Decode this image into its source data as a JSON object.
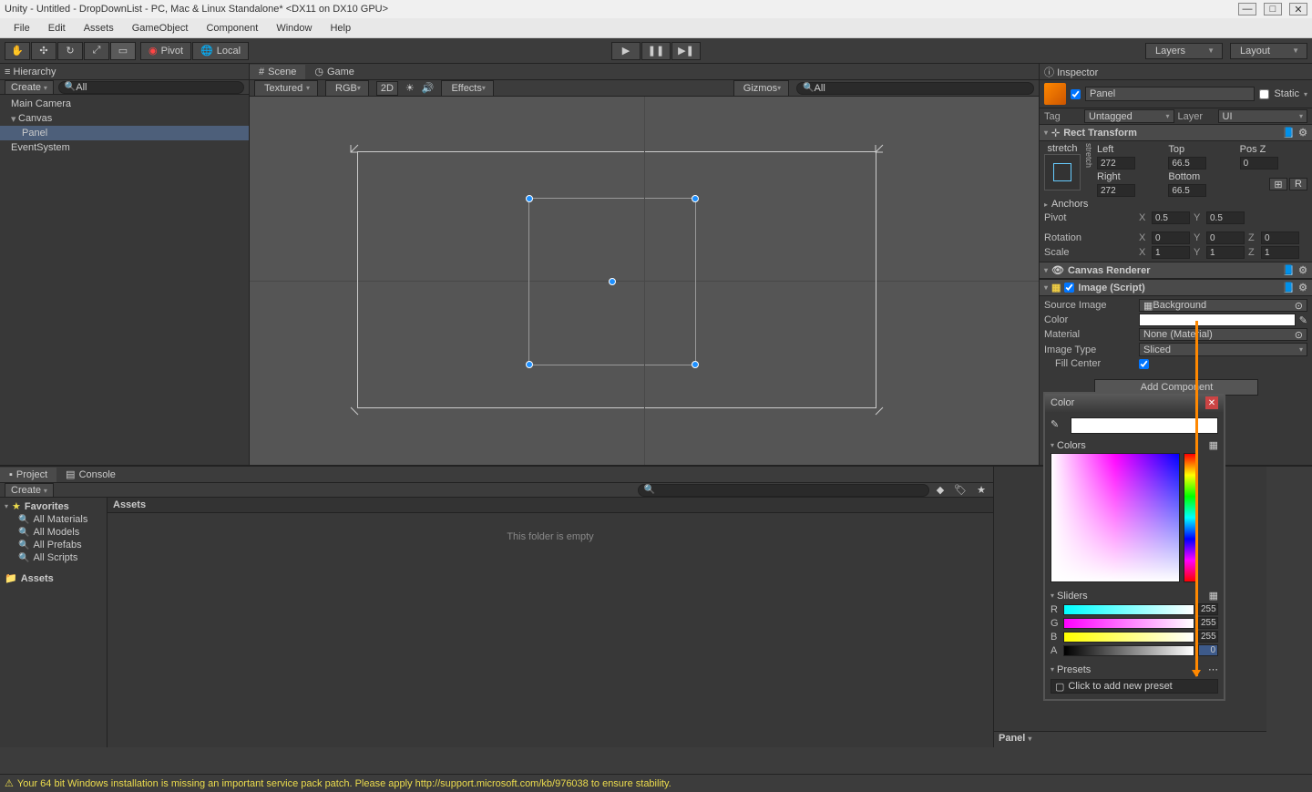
{
  "title": "Unity - Untitled - DropDownList - PC, Mac & Linux Standalone* <DX11 on DX10 GPU>",
  "menu": [
    "File",
    "Edit",
    "Assets",
    "GameObject",
    "Component",
    "Window",
    "Help"
  ],
  "toolbar": {
    "pivot": "Pivot",
    "local": "Local",
    "layers": "Layers",
    "layout": "Layout"
  },
  "hierarchy": {
    "title": "Hierarchy",
    "create": "Create",
    "search_placeholder": "All",
    "items": [
      "Main Camera",
      "Canvas",
      "Panel",
      "EventSystem"
    ]
  },
  "scene": {
    "tab_scene": "Scene",
    "tab_game": "Game",
    "shaded": "Textured",
    "rgb": "RGB",
    "twod": "2D",
    "effects": "Effects",
    "gizmos": "Gizmos",
    "search_placeholder": "All"
  },
  "inspector": {
    "title": "Inspector",
    "name": "Panel",
    "static": "Static",
    "tag_label": "Tag",
    "tag": "Untagged",
    "layer_label": "Layer",
    "layer": "UI",
    "rect_transform": {
      "title": "Rect Transform",
      "stretch": "stretch",
      "left": "Left",
      "left_v": "272",
      "top": "Top",
      "top_v": "66.5",
      "posz": "Pos Z",
      "posz_v": "0",
      "right": "Right",
      "right_v": "272",
      "bottom": "Bottom",
      "bottom_v": "66.5",
      "r_btn": "R",
      "anchors": "Anchors",
      "pivot": "Pivot",
      "pivot_x": "0.5",
      "pivot_y": "0.5",
      "rotation": "Rotation",
      "rot_x": "0",
      "rot_y": "0",
      "rot_z": "0",
      "scale": "Scale",
      "scale_x": "1",
      "scale_y": "1",
      "scale_z": "1"
    },
    "canvas_renderer": "Canvas Renderer",
    "image": {
      "title": "Image (Script)",
      "source_image": "Source Image",
      "source_image_v": "Background",
      "color": "Color",
      "material": "Material",
      "material_v": "None (Material)",
      "image_type": "Image Type",
      "image_type_v": "Sliced",
      "fill_center": "Fill Center"
    },
    "add_component": "Add Component",
    "footer": "Panel"
  },
  "project": {
    "tab_project": "Project",
    "tab_console": "Console",
    "create": "Create",
    "favorites": "Favorites",
    "fav_items": [
      "All Materials",
      "All Models",
      "All Prefabs",
      "All Scripts"
    ],
    "assets": "Assets",
    "path": "Assets",
    "empty": "This folder is empty"
  },
  "color_picker": {
    "title": "Color",
    "colors": "Colors",
    "sliders": "Sliders",
    "r": "R",
    "r_v": "255",
    "g": "G",
    "g_v": "255",
    "b": "B",
    "b_v": "255",
    "a": "A",
    "a_v": "0",
    "presets": "Presets",
    "preset_hint": "Click to add new preset"
  },
  "status": "Your 64 bit Windows installation is missing an important service pack patch. Please apply http://support.microsoft.com/kb/976038 to ensure stability."
}
